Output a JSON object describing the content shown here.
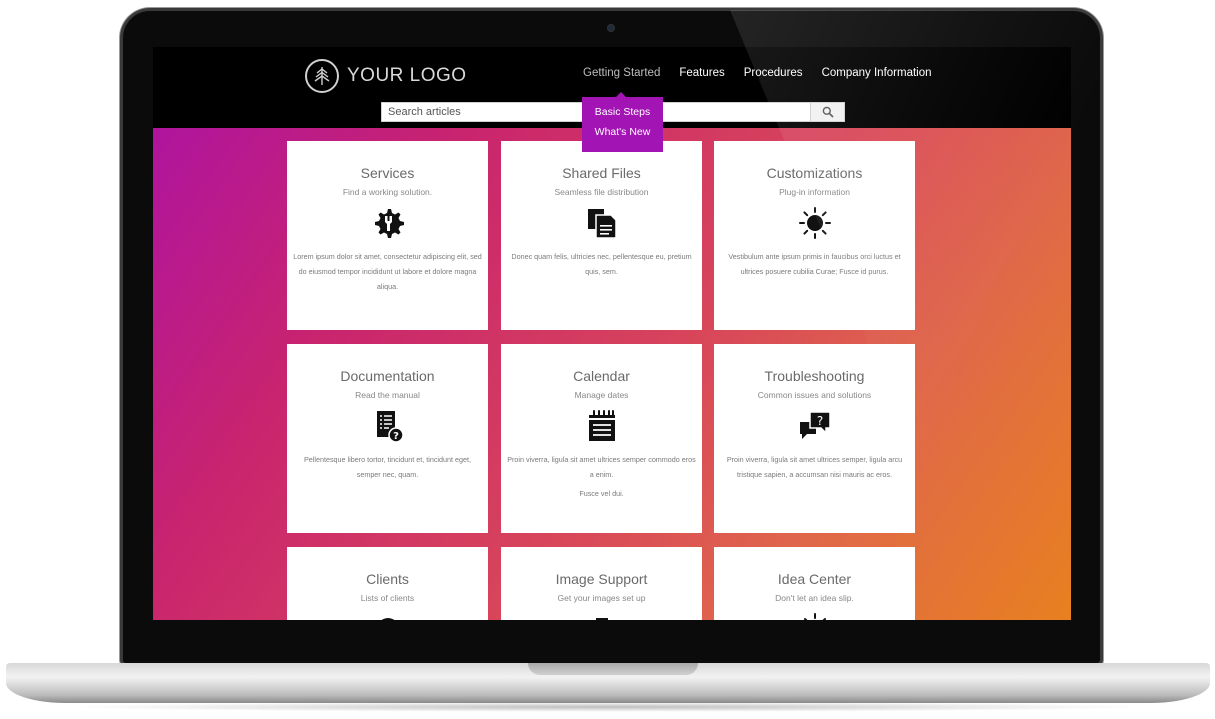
{
  "header": {
    "logo_text": "YOUR LOGO",
    "nav": [
      {
        "label": "Getting Started"
      },
      {
        "label": "Features"
      },
      {
        "label": "Procedures"
      },
      {
        "label": "Company Information"
      }
    ],
    "search": {
      "placeholder": "Search articles"
    },
    "dropdown": [
      {
        "label": "Basic Steps"
      },
      {
        "label": "What's New"
      }
    ]
  },
  "colors": {
    "dropdown": "#a314b4",
    "gradient_start": "#b0149e",
    "gradient_end": "#e8801f"
  },
  "cards": [
    {
      "title": "Services",
      "subtitle": "Find a working solution.",
      "icon": "gear-wrench-icon",
      "description": "Lorem ipsum dolor sit amet, consectetur adipiscing elit, sed do eiusmod tempor incididunt ut labore et dolore magna aliqua."
    },
    {
      "title": "Shared Files",
      "subtitle": "Seamless file distribution",
      "icon": "files-icon",
      "description": "Donec quam felis, ultricies nec, pellentesque eu, pretium quis, sem."
    },
    {
      "title": "Customizations",
      "subtitle": "Plug-in information",
      "icon": "sun-icon",
      "description": "Vestibulum ante ipsum primis in faucibus orci luctus et ultrices posuere cubilia Curae; Fusce id purus."
    },
    {
      "title": "Documentation",
      "subtitle": "Read the manual",
      "icon": "document-help-icon",
      "description": "Pellentesque libero tortor, tincidunt et, tincidunt eget, semper nec, quam."
    },
    {
      "title": "Calendar",
      "subtitle": "Manage dates",
      "icon": "calendar-icon",
      "description": "Proin viverra, ligula sit amet ultrices semper commodo eros a enim.",
      "description2": "Fusce vel dui."
    },
    {
      "title": "Troubleshooting",
      "subtitle": "Common issues and solutions",
      "icon": "chat-question-icon",
      "description": "Proin viverra, ligula sit amet ultrices semper, ligula arcu tristique sapien, a accumsan nisi mauris ac eros."
    },
    {
      "title": "Clients",
      "subtitle": "Lists of clients",
      "icon": "check-circle-icon",
      "description": ""
    },
    {
      "title": "Image Support",
      "subtitle": "Get your images set up",
      "icon": "camera-icon",
      "description": ""
    },
    {
      "title": "Idea Center",
      "subtitle": "Don't let an idea slip.",
      "icon": "lightbulb-icon",
      "description": ""
    }
  ]
}
